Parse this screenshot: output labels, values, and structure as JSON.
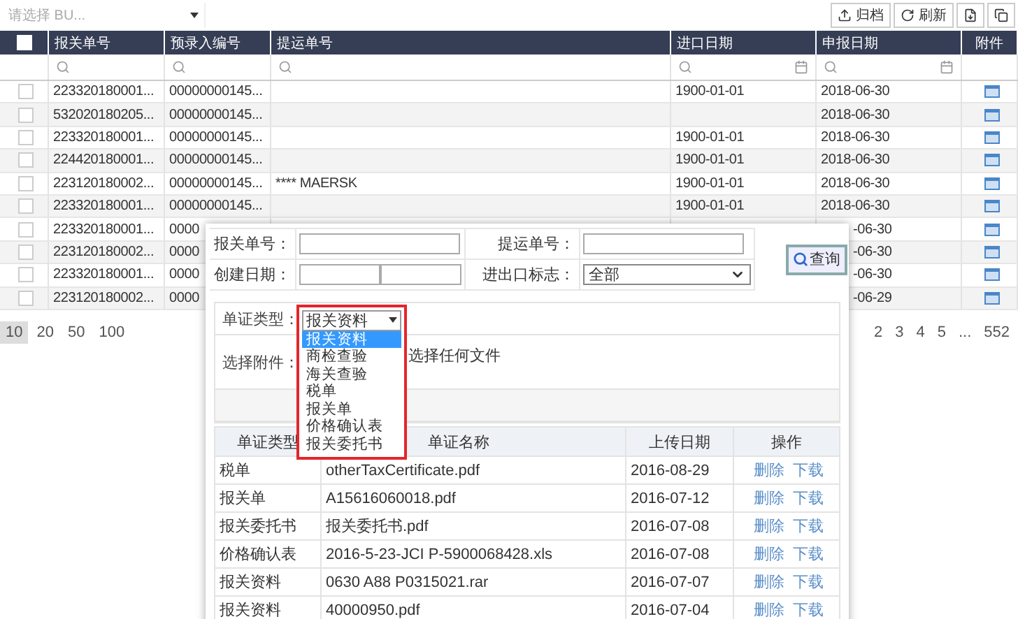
{
  "bu_select": {
    "placeholder": "请选择 BU..."
  },
  "toolbar": [
    {
      "kind": "archive",
      "label": "归档"
    },
    {
      "kind": "refresh",
      "label": "刷新"
    },
    {
      "kind": "export"
    },
    {
      "kind": "copy"
    }
  ],
  "table": {
    "select_all": {
      "checked": false
    },
    "columns": [
      "报关单号",
      "预录入编号",
      "提运单号",
      "进口日期",
      "申报日期",
      "附件"
    ],
    "rows": [
      {
        "checked": false,
        "covered": false,
        "declaration_no": "223320180001...",
        "entry_no": "00000000145...",
        "import_date": "1900-01-01",
        "declare_date": "2018-06-30"
      },
      {
        "checked": false,
        "covered": false,
        "declaration_no": "532020180205...",
        "entry_no": "00000000145...",
        "declare_date": "2018-06-30"
      },
      {
        "checked": false,
        "covered": false,
        "declaration_no": "223320180001...",
        "entry_no": "00000000145...",
        "import_date": "1900-01-01",
        "declare_date": "2018-06-30"
      },
      {
        "checked": false,
        "covered": false,
        "declaration_no": "224420180001...",
        "entry_no": "00000000145...",
        "import_date": "1900-01-01",
        "declare_date": "2018-06-30"
      },
      {
        "checked": false,
        "covered": false,
        "declaration_no": "223120180002...",
        "entry_no": "00000000145...",
        "bill_no": "**** MAERSK",
        "import_date": "1900-01-01",
        "declare_date": "2018-06-30"
      },
      {
        "checked": false,
        "covered": false,
        "declaration_no": "223320180001...",
        "entry_no": "00000000145...",
        "import_date": "1900-01-01",
        "declare_date": "2018-06-30"
      },
      {
        "checked": false,
        "covered": true,
        "declaration_no": "223320180001...",
        "entry_no": "0000",
        "declare_date": "-06-30"
      },
      {
        "checked": false,
        "covered": true,
        "declaration_no": "223120180002...",
        "entry_no": "0000",
        "declare_date": "-06-30"
      },
      {
        "checked": false,
        "covered": true,
        "declaration_no": "223320180001...",
        "entry_no": "0000",
        "declare_date": "-06-30"
      },
      {
        "checked": false,
        "covered": true,
        "declaration_no": "223120180002...",
        "entry_no": "0000",
        "declare_date": "-06-29"
      }
    ]
  },
  "pager": {
    "page_sizes": [
      {
        "label": "10",
        "selected": true
      },
      {
        "label": "20",
        "selected": false
      },
      {
        "label": "50",
        "selected": false
      },
      {
        "label": "100",
        "selected": false
      }
    ],
    "pages": [
      "2",
      "3",
      "4",
      "5",
      "...",
      "552"
    ]
  },
  "dialog": {
    "search": {
      "fields": [
        {
          "label": "报关单号：",
          "kind": "text"
        },
        {
          "label": "提运单号：",
          "kind": "text"
        },
        {
          "label": "创建日期：",
          "kind": "date_range"
        },
        {
          "label": "进出口标志：",
          "kind": "select",
          "value": "全部"
        }
      ],
      "button": "查询"
    },
    "upload": {
      "type_label": "单证类型：",
      "type_value": "报关资料",
      "options": [
        {
          "label": "报关资料",
          "selected": true
        },
        {
          "label": "商检查验",
          "selected": false
        },
        {
          "label": "海关查验",
          "selected": false
        },
        {
          "label": "税单",
          "selected": false
        },
        {
          "label": "报关单",
          "selected": false
        },
        {
          "label": "价格确认表",
          "selected": false
        },
        {
          "label": "报关委托书",
          "selected": false
        }
      ],
      "file_label": "选择附件：",
      "file_status": "选择任何文件"
    },
    "files": {
      "columns": [
        "单证类型",
        "单证名称",
        "上传日期",
        "操作"
      ],
      "rows": [
        {
          "type": "税单",
          "name": "otherTaxCertificate.pdf",
          "date": "2016-08-29",
          "actions": [
            "删除",
            "下载"
          ]
        },
        {
          "type": "报关单",
          "name": "A15616060018.pdf",
          "date": "2016-07-12",
          "actions": [
            "删除",
            "下载"
          ]
        },
        {
          "type": "报关委托书",
          "name": "报关委托书.pdf",
          "date": "2016-07-08",
          "actions": [
            "删除",
            "下载"
          ]
        },
        {
          "type": "价格确认表",
          "name": "2016-5-23-JCI P-5900068428.xls",
          "date": "2016-07-08",
          "actions": [
            "删除",
            "下载"
          ]
        },
        {
          "type": "报关资料",
          "name": "0630 A88 P0315021.rar",
          "date": "2016-07-07",
          "actions": [
            "删除",
            "下载"
          ]
        },
        {
          "type": "报关资料",
          "name": "40000950.pdf",
          "date": "2016-07-04",
          "actions": [
            "删除",
            "下载"
          ]
        }
      ]
    }
  }
}
